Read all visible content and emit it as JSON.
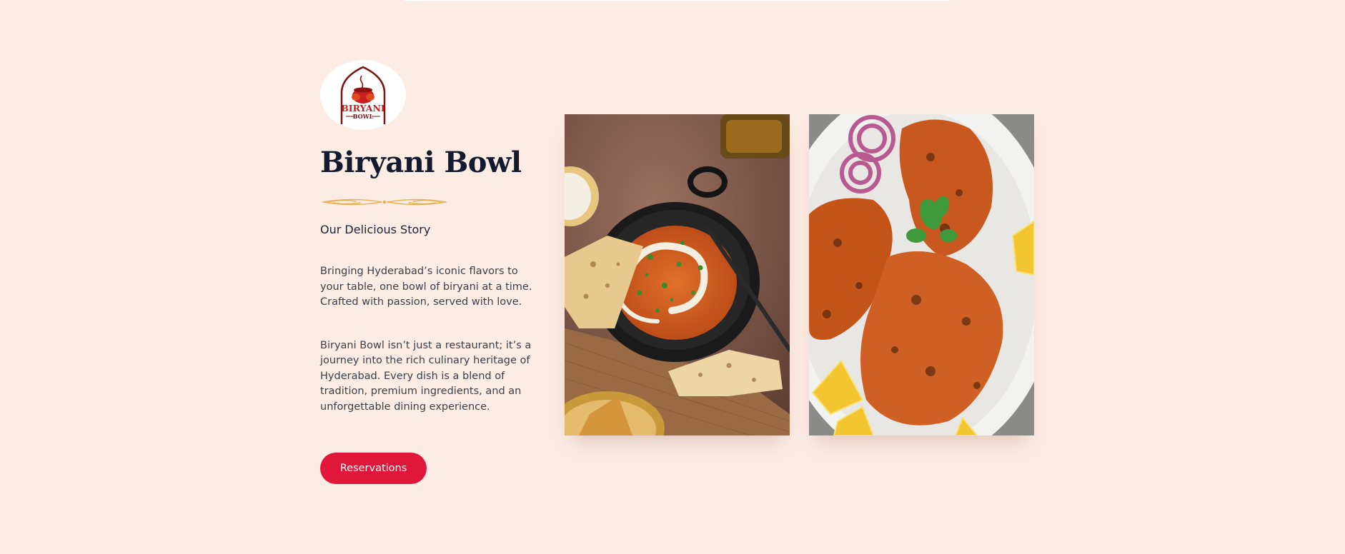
{
  "brand": {
    "logo_text_main": "BIRYANI",
    "logo_text_sub": "BOWL",
    "title": "Biryani Bowl"
  },
  "story": {
    "subtitle": "Our Delicious Story",
    "paragraph_1": "Bringing Hyderabad’s iconic flavors to your table, one bowl of biryani at a time. Crafted with passion, served with love.",
    "paragraph_2": "Biryani Bowl isn’t just a restaurant; it’s a journey into the rich culinary heritage of Hyderabad. Every dish is a blend of tradition, premium ingredients, and an unforgettable dining experience."
  },
  "actions": {
    "reservations_label": "Reservations"
  },
  "images": {
    "photo_1": "butter-chicken-with-naan-photo",
    "photo_2": "tandoori-chicken-platter-photo"
  },
  "colors": {
    "background": "#fdece4",
    "accent": "#e0173b",
    "heading": "#141a2e",
    "divider_gold": "#e3b35a"
  }
}
